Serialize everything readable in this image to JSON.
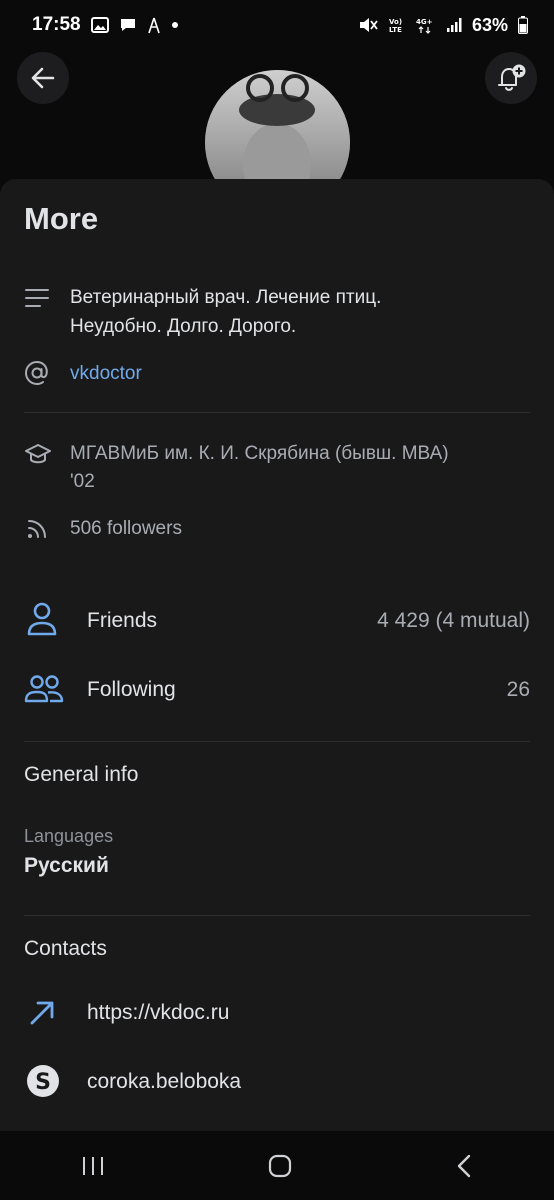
{
  "status": {
    "time": "17:58",
    "battery": "63%"
  },
  "header": {
    "back_icon": "arrow-left-icon",
    "bell_icon": "bell-add-icon"
  },
  "sheet": {
    "title": "More",
    "bio_line1": "Ветеринарный врач. Лечение птиц.",
    "bio_line2": "Неудобно. Долго. Дорого.",
    "username": "vkdoctor",
    "education_line1": "МГАВМиБ им. К. И. Скрябина (бывш. МВА)",
    "education_line2": "'02",
    "followers": "506 followers",
    "friends_label": "Friends",
    "friends_value": "4 429 (4 mutual)",
    "following_label": "Following",
    "following_value": "26",
    "general_info_heading": "General info",
    "languages_label": "Languages",
    "languages_value": "Русский",
    "contacts_heading": "Contacts",
    "website": "https://vkdoc.ru",
    "skype": "coroka.beloboka"
  },
  "colors": {
    "accent": "#71aaeb",
    "background": "#0a0a0a",
    "sheet": "#19191a"
  }
}
